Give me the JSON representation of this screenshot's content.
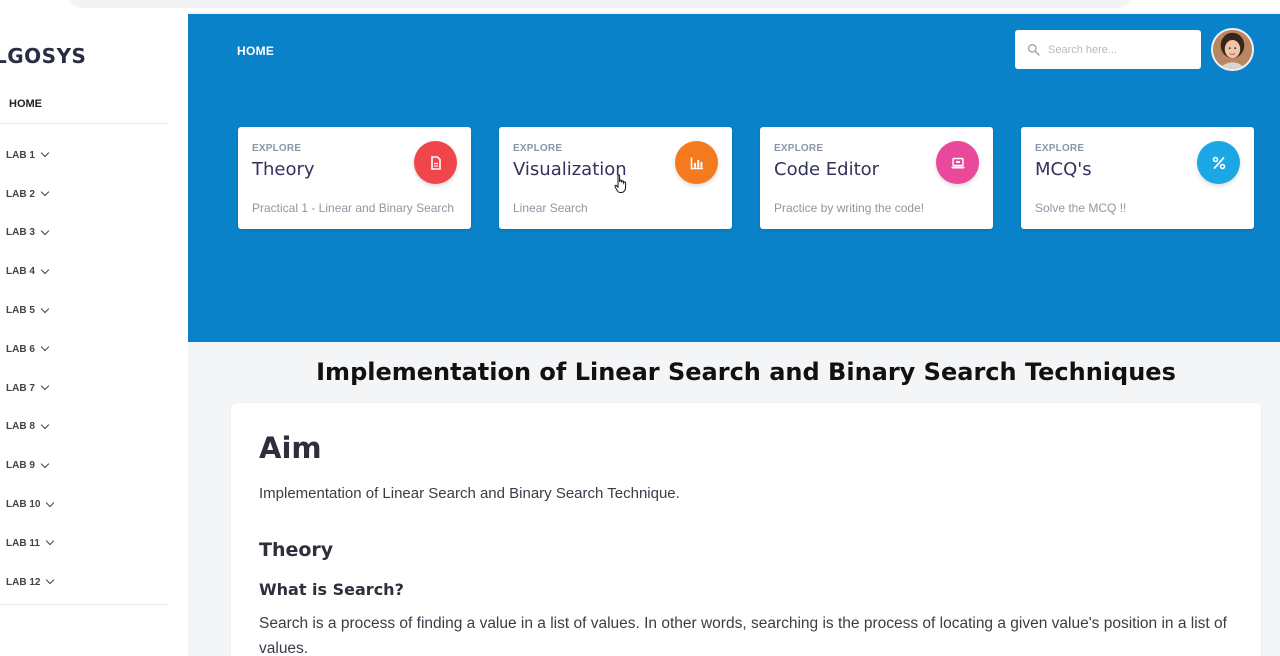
{
  "sidebar": {
    "brand": "LGOSYS",
    "home": "HOME",
    "labs": [
      "LAB 1",
      "LAB 2",
      "LAB 3",
      "LAB 4",
      "LAB 5",
      "LAB 6",
      "LAB 7",
      "LAB 8",
      "LAB 9",
      "LAB 10",
      "LAB 11",
      "LAB 12"
    ]
  },
  "header": {
    "breadcrumb": "HOME",
    "search_placeholder": "Search here..."
  },
  "cards": [
    {
      "kicker": "EXPLORE",
      "title": "Theory",
      "subtitle": "Practical 1 - Linear and Binary Search",
      "icon": "document-icon",
      "color": "#f0454b"
    },
    {
      "kicker": "EXPLORE",
      "title": "Visualization",
      "subtitle": "Linear Search",
      "icon": "bar-chart-icon",
      "color": "#f57a1e"
    },
    {
      "kicker": "EXPLORE",
      "title": "Code Editor",
      "subtitle": "Practice by writing the code!",
      "icon": "laptop-icon",
      "color": "#e9489b"
    },
    {
      "kicker": "EXPLORE",
      "title": "MCQ's",
      "subtitle": "Solve the MCQ !!",
      "icon": "percent-icon",
      "color": "#1ba7e6"
    }
  ],
  "main": {
    "heading": "Implementation of Linear Search and Binary Search Techniques",
    "aim_title": "Aim",
    "aim_text": "Implementation of Linear Search and Binary Search Technique.",
    "theory_title": "Theory",
    "question": "What is Search?",
    "paragraph": "Search is a process of finding a value in a list of values. In other words, searching is the process of locating a given value's position in a list of values."
  },
  "colors": {
    "hero": "#0a82c9",
    "background": "#f4f5f7"
  }
}
